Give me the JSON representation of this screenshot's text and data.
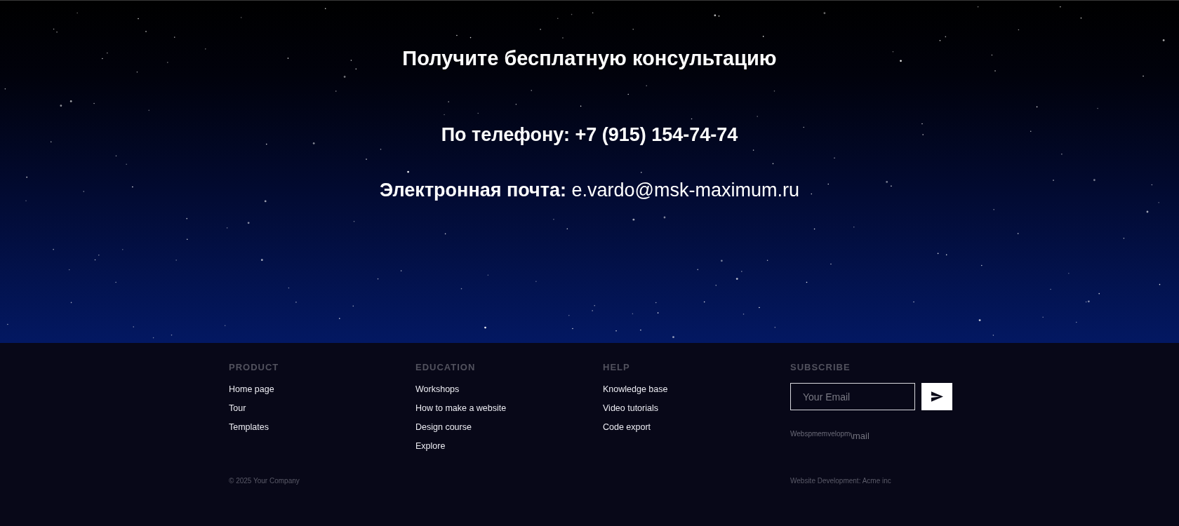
{
  "consultation": {
    "title": "Получите бесплатную консультацию",
    "phone": "По телефону: +7 (915) 154-74-74",
    "email": "**Электронная почта:** e.vardo@msk-maximum.ru"
  },
  "footer": {
    "columns": [
      {
        "heading": "PRODUCT",
        "links": [
          "Home page",
          "Tour",
          "Templates"
        ]
      },
      {
        "heading": "EDUCATION",
        "links": [
          "Workshops",
          "How to make a website",
          "Design course",
          "Explore"
        ]
      },
      {
        "heading": "HELP",
        "links": [
          "Knowledge base",
          "Video tutorials",
          "Code export"
        ]
      }
    ],
    "subscribe": {
      "heading": "SUBSCRIBE",
      "placeholder": "Your Email",
      "overlap_text": [
        "Webspmemvelopm",
        "\\mail"
      ]
    },
    "copyright": "© 2025 Your Company",
    "credit": "Website Development: Acme inc"
  }
}
